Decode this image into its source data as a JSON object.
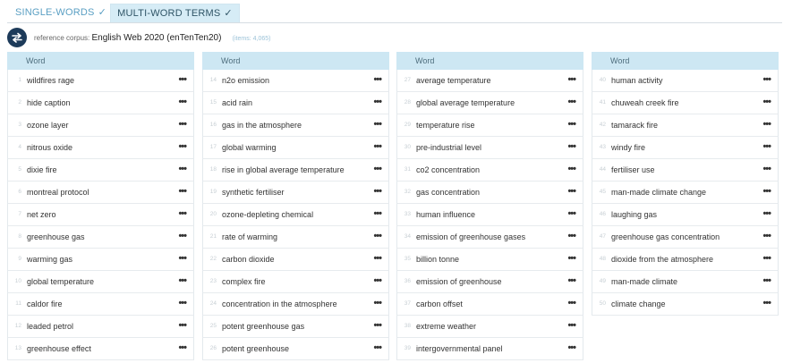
{
  "tabs": [
    {
      "label": "SINGLE-WORDS",
      "check": "✓"
    },
    {
      "label": "MULTI-WORD TERMS",
      "check": "✓"
    }
  ],
  "corpus": {
    "prefix": "reference corpus:",
    "name": "English Web 2020 (enTenTen20)",
    "items": "(items: 4,065)"
  },
  "columns": [
    {
      "header": "Word",
      "rows": [
        {
          "num": "1",
          "term": "wildfires rage"
        },
        {
          "num": "2",
          "term": "hide caption"
        },
        {
          "num": "3",
          "term": "ozone layer"
        },
        {
          "num": "4",
          "term": "nitrous oxide"
        },
        {
          "num": "5",
          "term": "dixie fire"
        },
        {
          "num": "6",
          "term": "montreal protocol"
        },
        {
          "num": "7",
          "term": "net zero"
        },
        {
          "num": "8",
          "term": "greenhouse gas"
        },
        {
          "num": "9",
          "term": "warming gas"
        },
        {
          "num": "10",
          "term": "global temperature"
        },
        {
          "num": "11",
          "term": "caldor fire"
        },
        {
          "num": "12",
          "term": "leaded petrol"
        },
        {
          "num": "13",
          "term": "greenhouse effect"
        }
      ]
    },
    {
      "header": "Word",
      "rows": [
        {
          "num": "14",
          "term": "n2o emission"
        },
        {
          "num": "15",
          "term": "acid rain"
        },
        {
          "num": "16",
          "term": "gas in the atmosphere"
        },
        {
          "num": "17",
          "term": "global warming"
        },
        {
          "num": "18",
          "term": "rise in global average temperature"
        },
        {
          "num": "19",
          "term": "synthetic fertiliser"
        },
        {
          "num": "20",
          "term": "ozone-depleting chemical"
        },
        {
          "num": "21",
          "term": "rate of warming"
        },
        {
          "num": "22",
          "term": "carbon dioxide"
        },
        {
          "num": "23",
          "term": "complex fire"
        },
        {
          "num": "24",
          "term": "concentration in the atmosphere"
        },
        {
          "num": "25",
          "term": "potent greenhouse gas"
        },
        {
          "num": "26",
          "term": "potent greenhouse"
        }
      ]
    },
    {
      "header": "Word",
      "rows": [
        {
          "num": "27",
          "term": "average temperature"
        },
        {
          "num": "28",
          "term": "global average temperature"
        },
        {
          "num": "29",
          "term": "temperature rise"
        },
        {
          "num": "30",
          "term": "pre-industrial level"
        },
        {
          "num": "31",
          "term": "co2 concentration"
        },
        {
          "num": "32",
          "term": "gas concentration"
        },
        {
          "num": "33",
          "term": "human influence"
        },
        {
          "num": "34",
          "term": "emission of greenhouse gases"
        },
        {
          "num": "35",
          "term": "billion tonne"
        },
        {
          "num": "36",
          "term": "emission of greenhouse"
        },
        {
          "num": "37",
          "term": "carbon offset"
        },
        {
          "num": "38",
          "term": "extreme weather"
        },
        {
          "num": "39",
          "term": "intergovernmental panel"
        }
      ]
    },
    {
      "header": "Word",
      "rows": [
        {
          "num": "40",
          "term": "human activity"
        },
        {
          "num": "41",
          "term": "chuweah creek fire"
        },
        {
          "num": "42",
          "term": "tamarack fire"
        },
        {
          "num": "43",
          "term": "windy fire"
        },
        {
          "num": "44",
          "term": "fertiliser use"
        },
        {
          "num": "45",
          "term": "man-made climate change"
        },
        {
          "num": "46",
          "term": "laughing gas"
        },
        {
          "num": "47",
          "term": "greenhouse gas concentration"
        },
        {
          "num": "48",
          "term": "dioxide from the atmosphere"
        },
        {
          "num": "49",
          "term": "man-made climate"
        },
        {
          "num": "50",
          "term": "climate change"
        }
      ]
    }
  ],
  "row_menu_label": "•••"
}
